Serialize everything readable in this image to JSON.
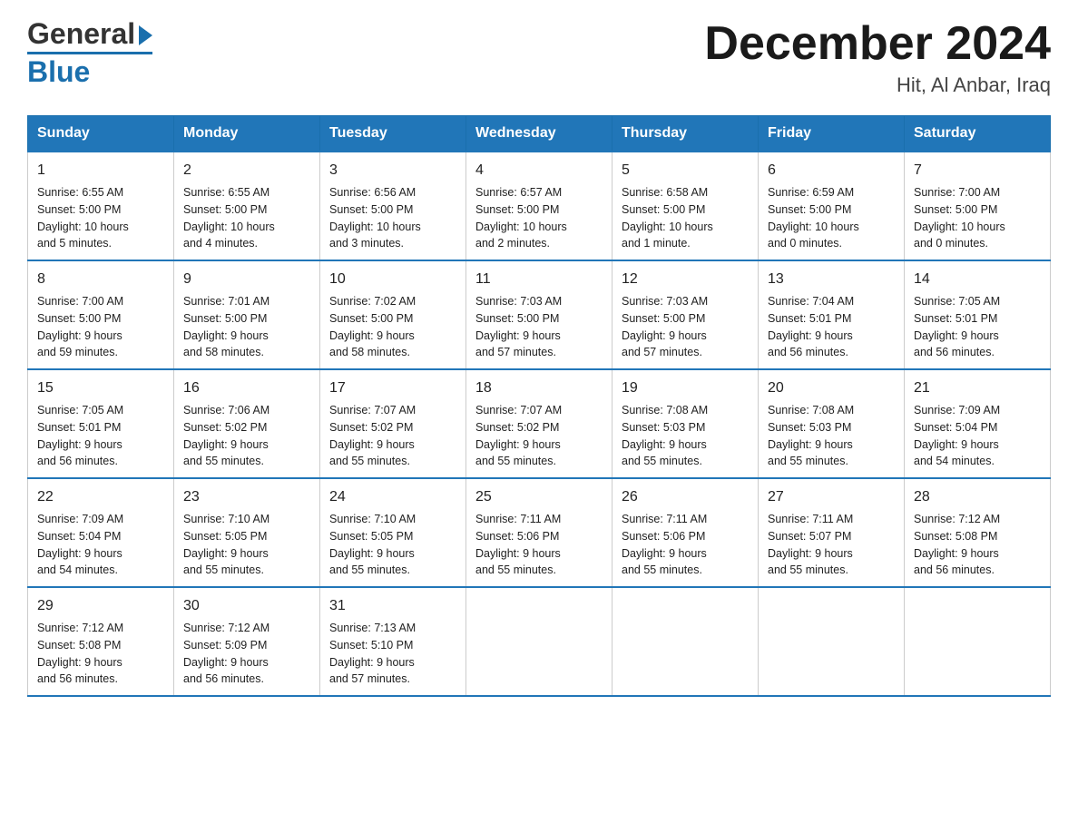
{
  "logo": {
    "line1": "General",
    "line2": "Blue"
  },
  "title": {
    "month_year": "December 2024",
    "location": "Hit, Al Anbar, Iraq"
  },
  "weekdays": [
    "Sunday",
    "Monday",
    "Tuesday",
    "Wednesday",
    "Thursday",
    "Friday",
    "Saturday"
  ],
  "weeks": [
    [
      {
        "day": "1",
        "sunrise": "6:55 AM",
        "sunset": "5:00 PM",
        "daylight": "10 hours and 5 minutes."
      },
      {
        "day": "2",
        "sunrise": "6:55 AM",
        "sunset": "5:00 PM",
        "daylight": "10 hours and 4 minutes."
      },
      {
        "day": "3",
        "sunrise": "6:56 AM",
        "sunset": "5:00 PM",
        "daylight": "10 hours and 3 minutes."
      },
      {
        "day": "4",
        "sunrise": "6:57 AM",
        "sunset": "5:00 PM",
        "daylight": "10 hours and 2 minutes."
      },
      {
        "day": "5",
        "sunrise": "6:58 AM",
        "sunset": "5:00 PM",
        "daylight": "10 hours and 1 minute."
      },
      {
        "day": "6",
        "sunrise": "6:59 AM",
        "sunset": "5:00 PM",
        "daylight": "10 hours and 0 minutes."
      },
      {
        "day": "7",
        "sunrise": "7:00 AM",
        "sunset": "5:00 PM",
        "daylight": "10 hours and 0 minutes."
      }
    ],
    [
      {
        "day": "8",
        "sunrise": "7:00 AM",
        "sunset": "5:00 PM",
        "daylight": "9 hours and 59 minutes."
      },
      {
        "day": "9",
        "sunrise": "7:01 AM",
        "sunset": "5:00 PM",
        "daylight": "9 hours and 58 minutes."
      },
      {
        "day": "10",
        "sunrise": "7:02 AM",
        "sunset": "5:00 PM",
        "daylight": "9 hours and 58 minutes."
      },
      {
        "day": "11",
        "sunrise": "7:03 AM",
        "sunset": "5:00 PM",
        "daylight": "9 hours and 57 minutes."
      },
      {
        "day": "12",
        "sunrise": "7:03 AM",
        "sunset": "5:00 PM",
        "daylight": "9 hours and 57 minutes."
      },
      {
        "day": "13",
        "sunrise": "7:04 AM",
        "sunset": "5:01 PM",
        "daylight": "9 hours and 56 minutes."
      },
      {
        "day": "14",
        "sunrise": "7:05 AM",
        "sunset": "5:01 PM",
        "daylight": "9 hours and 56 minutes."
      }
    ],
    [
      {
        "day": "15",
        "sunrise": "7:05 AM",
        "sunset": "5:01 PM",
        "daylight": "9 hours and 56 minutes."
      },
      {
        "day": "16",
        "sunrise": "7:06 AM",
        "sunset": "5:02 PM",
        "daylight": "9 hours and 55 minutes."
      },
      {
        "day": "17",
        "sunrise": "7:07 AM",
        "sunset": "5:02 PM",
        "daylight": "9 hours and 55 minutes."
      },
      {
        "day": "18",
        "sunrise": "7:07 AM",
        "sunset": "5:02 PM",
        "daylight": "9 hours and 55 minutes."
      },
      {
        "day": "19",
        "sunrise": "7:08 AM",
        "sunset": "5:03 PM",
        "daylight": "9 hours and 55 minutes."
      },
      {
        "day": "20",
        "sunrise": "7:08 AM",
        "sunset": "5:03 PM",
        "daylight": "9 hours and 55 minutes."
      },
      {
        "day": "21",
        "sunrise": "7:09 AM",
        "sunset": "5:04 PM",
        "daylight": "9 hours and 54 minutes."
      }
    ],
    [
      {
        "day": "22",
        "sunrise": "7:09 AM",
        "sunset": "5:04 PM",
        "daylight": "9 hours and 54 minutes."
      },
      {
        "day": "23",
        "sunrise": "7:10 AM",
        "sunset": "5:05 PM",
        "daylight": "9 hours and 55 minutes."
      },
      {
        "day": "24",
        "sunrise": "7:10 AM",
        "sunset": "5:05 PM",
        "daylight": "9 hours and 55 minutes."
      },
      {
        "day": "25",
        "sunrise": "7:11 AM",
        "sunset": "5:06 PM",
        "daylight": "9 hours and 55 minutes."
      },
      {
        "day": "26",
        "sunrise": "7:11 AM",
        "sunset": "5:06 PM",
        "daylight": "9 hours and 55 minutes."
      },
      {
        "day": "27",
        "sunrise": "7:11 AM",
        "sunset": "5:07 PM",
        "daylight": "9 hours and 55 minutes."
      },
      {
        "day": "28",
        "sunrise": "7:12 AM",
        "sunset": "5:08 PM",
        "daylight": "9 hours and 56 minutes."
      }
    ],
    [
      {
        "day": "29",
        "sunrise": "7:12 AM",
        "sunset": "5:08 PM",
        "daylight": "9 hours and 56 minutes."
      },
      {
        "day": "30",
        "sunrise": "7:12 AM",
        "sunset": "5:09 PM",
        "daylight": "9 hours and 56 minutes."
      },
      {
        "day": "31",
        "sunrise": "7:13 AM",
        "sunset": "5:10 PM",
        "daylight": "9 hours and 57 minutes."
      },
      null,
      null,
      null,
      null
    ]
  ],
  "labels": {
    "sunrise": "Sunrise:",
    "sunset": "Sunset:",
    "daylight": "Daylight:"
  }
}
